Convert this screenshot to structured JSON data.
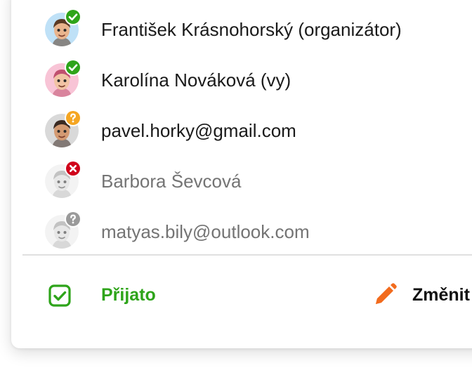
{
  "attendees": [
    {
      "name": "František Krásnohorský (organizátor)",
      "status": "accepted",
      "status_icon": "check-icon",
      "avatar_bg": "#bfe1f7",
      "skin": "#e8b48d",
      "hair": "#5a3a24",
      "muted": false
    },
    {
      "name": "Karolína Nováková (vy)",
      "status": "accepted",
      "status_icon": "check-icon",
      "avatar_bg": "#f8c4d6",
      "skin": "#f1c3a4",
      "hair": "#c0506f",
      "muted": false
    },
    {
      "name": "pavel.horky@gmail.com",
      "status": "pending",
      "status_icon": "question-icon",
      "avatar_bg": "#d9d9d9",
      "skin": "#d39a72",
      "hair": "#3a2a22",
      "muted": false
    },
    {
      "name": "Barbora Ševcová",
      "status": "declined",
      "status_icon": "x-icon",
      "avatar_bg": "#ececec",
      "skin": "#d8d8d8",
      "hair": "#9a9a9a",
      "muted": true
    },
    {
      "name": "matyas.bily@outlook.com",
      "status": "unknown",
      "status_icon": "question-icon",
      "avatar_bg": "#ececec",
      "skin": "#d8d8d8",
      "hair": "#9a9a9a",
      "muted": true
    }
  ],
  "status_colors": {
    "accepted": "#2ea41a",
    "pending": "#f5a623",
    "declined": "#d0021b",
    "unknown": "#9a9a9a"
  },
  "footer": {
    "rsvp_label": "Přijato",
    "rsvp_icon": "checkbox-check-icon",
    "rsvp_color": "#2ea41a",
    "change_label": "Změnit",
    "change_icon": "pencil-icon",
    "change_icon_color": "#f26b1d"
  }
}
